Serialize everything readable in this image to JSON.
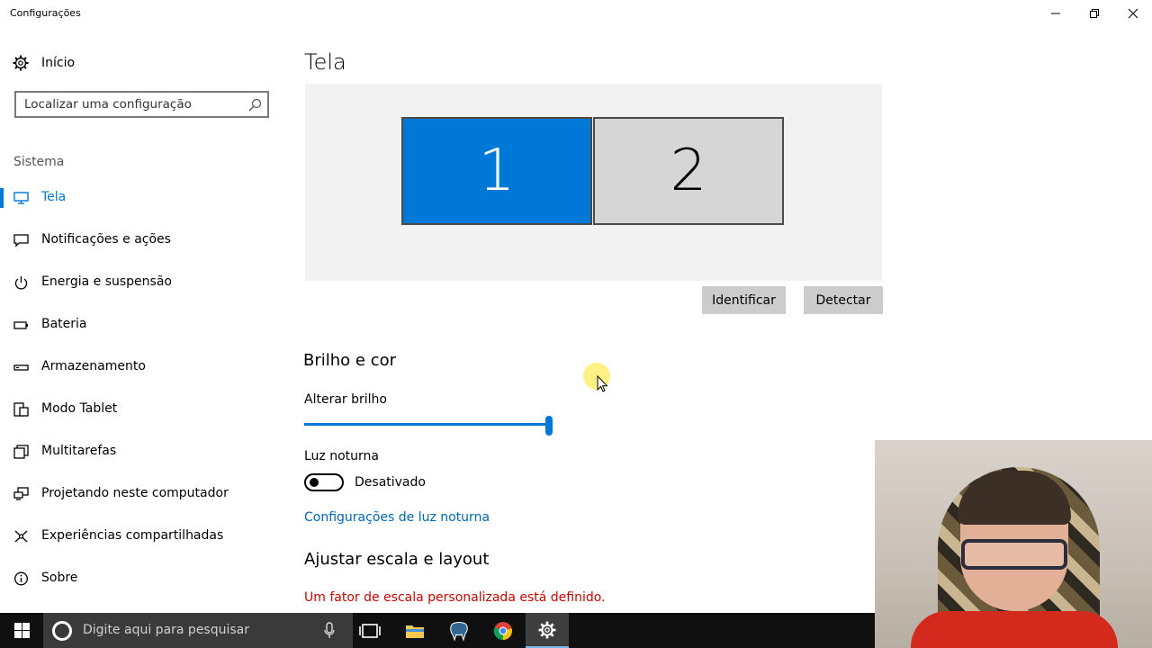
{
  "window": {
    "title": "Configurações",
    "buttons": {
      "minimize": "minimize-icon",
      "restore": "restore-icon",
      "close": "close-icon"
    }
  },
  "sidebar": {
    "home_label": "Início",
    "search_placeholder": "Localizar uma configuração",
    "section_label": "Sistema",
    "items": [
      {
        "label": "Tela",
        "icon": "monitor-icon",
        "active": true
      },
      {
        "label": "Notificações e ações",
        "icon": "notification-icon"
      },
      {
        "label": "Energia e suspensão",
        "icon": "power-icon"
      },
      {
        "label": "Bateria",
        "icon": "battery-icon"
      },
      {
        "label": "Armazenamento",
        "icon": "storage-icon"
      },
      {
        "label": "Modo Tablet",
        "icon": "tablet-icon"
      },
      {
        "label": "Multitarefas",
        "icon": "multitask-icon"
      },
      {
        "label": "Projetando neste computador",
        "icon": "project-icon"
      },
      {
        "label": "Experiências compartilhadas",
        "icon": "shared-icon"
      },
      {
        "label": "Sobre",
        "icon": "info-icon"
      }
    ]
  },
  "main": {
    "page_title": "Tela",
    "monitors": [
      "1",
      "2"
    ],
    "identify_button": "Identificar",
    "detect_button": "Detectar",
    "brightness_heading": "Brilho e cor",
    "brightness_label": "Alterar brilho",
    "brightness_value": 1.0,
    "night_light_label": "Luz noturna",
    "night_light_state": "Desativado",
    "night_light_on": false,
    "night_light_link": "Configurações de luz noturna",
    "scale_heading": "Ajustar escala e layout",
    "scale_warning": "Um fator de escala personalizada está definido."
  },
  "taskbar": {
    "search_placeholder": "Digite aqui para pesquisar",
    "apps": [
      "task-view-icon",
      "file-explorer-icon",
      "elephant-app-icon",
      "chrome-icon",
      "settings-gear-icon"
    ],
    "active_app": "settings-gear-icon"
  },
  "colors": {
    "accent": "#0078d7",
    "link": "#0067b8",
    "warning": "#c50500",
    "taskbar": "#101010"
  }
}
